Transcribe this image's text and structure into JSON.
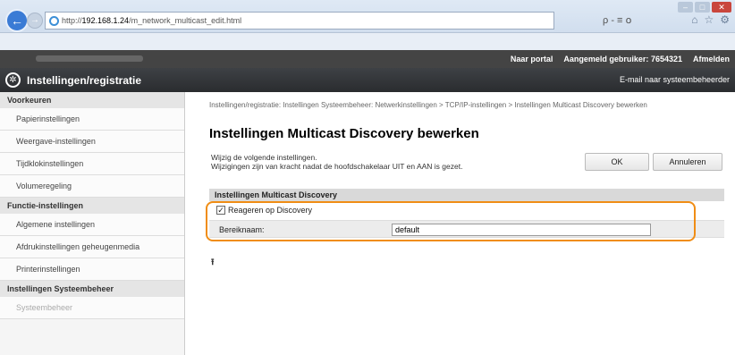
{
  "browser": {
    "url_prefix": "http://",
    "url_host": "192.168.1.24",
    "url_path": "/m_network_multicast_edit.html",
    "search_label": "ρ - ≡ ໐",
    "back_glyph": "←",
    "forward_glyph": "→",
    "home_glyph": "⌂",
    "star_glyph": "☆",
    "gear_glyph": "⚙"
  },
  "portal": {
    "to_portal": "Naar portal",
    "user_label": "Aangemeld gebruiker:",
    "user_id": "7654321",
    "logout": "Afmelden"
  },
  "header": {
    "title": "Instellingen/registratie",
    "mail_admin": "E-mail naar systeembeheerder"
  },
  "sidebar": {
    "sections": [
      {
        "heading": "Voorkeuren",
        "items": [
          "Papierinstellingen",
          "Weergave-instellingen",
          "Tijdklokinstellingen",
          "Volumeregeling"
        ]
      },
      {
        "heading": "Functie-instellingen",
        "items": [
          "Algemene instellingen",
          "Afdrukinstellingen geheugenmedia",
          "Printerinstellingen"
        ]
      },
      {
        "heading": "Instellingen Systeembeheer",
        "items": [
          "Systeembeheer"
        ]
      }
    ]
  },
  "main": {
    "breadcrumb": "Instellingen/registratie: Instellingen Systeembeheer: Netwerkinstellingen > TCP/IP-instellingen > Instellingen Multicast Discovery bewerken",
    "title": "Instellingen Multicast Discovery bewerken",
    "message_line1": "Wijzig de volgende instellingen.",
    "message_line2": "Wijzigingen zijn van kracht nadat de hoofdschakelaar UIT en AAN is gezet.",
    "ok_label": "OK",
    "cancel_label": "Annuleren",
    "panel_title": "Instellingen Multicast Discovery",
    "checkbox_label": "Reageren op Discovery",
    "checkbox_checked": true,
    "scope_label": "Bereiknaam:",
    "scope_value": "default",
    "top_glyph": "⭱"
  },
  "colors": {
    "highlight": "#f08d15",
    "header_bg": "#2a2c2f",
    "back_button": "#3a7bd5"
  }
}
